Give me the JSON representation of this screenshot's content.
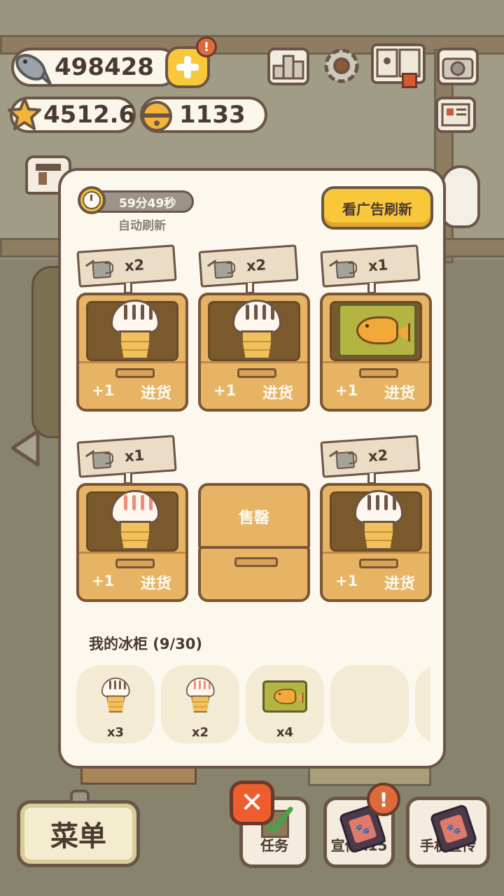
{
  "currencies": {
    "fish": "498428",
    "star": "4512.6",
    "bell": "1133"
  },
  "refresh": {
    "timer": "59分49秒",
    "auto_label": "自动刷新",
    "ad_button": "看广告刷新"
  },
  "stalls": [
    {
      "qty": "x2",
      "item": "icecream-choco",
      "plus": "+1",
      "restock": "进货"
    },
    {
      "qty": "x2",
      "item": "icecream-choco",
      "plus": "+1",
      "restock": "进货"
    },
    {
      "qty": "x1",
      "item": "taiyaki",
      "plus": "+1",
      "restock": "进货"
    },
    {
      "qty": "x1",
      "item": "icecream-strawberry",
      "plus": "+1",
      "restock": "进货"
    },
    {
      "soldout": "售罄"
    },
    {
      "qty": "x2",
      "item": "icecream-choco",
      "plus": "+1",
      "restock": "进货"
    }
  ],
  "freezer": {
    "title": "我的冰柜 (9/30)",
    "items": [
      {
        "item": "icecream-choco",
        "count": "x3"
      },
      {
        "item": "icecream-strawberry",
        "count": "x2"
      },
      {
        "item": "taiyaki",
        "count": "x4"
      }
    ]
  },
  "bottom": {
    "menu": "菜单",
    "tasks": "任务",
    "promote": "宣传x15",
    "phone_promote": "手机宣传",
    "close_symbol": "✕",
    "alert_symbol": "!"
  },
  "colors": {
    "accent_yellow": "#f8c83a",
    "close_red": "#ee5d2e",
    "panel_bg": "#fdf8ee",
    "outline": "#6b5546"
  }
}
